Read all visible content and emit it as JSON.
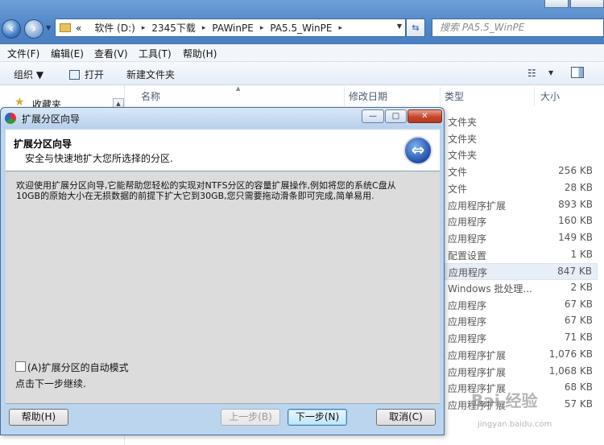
{
  "explorer": {
    "address": {
      "overflow": "«",
      "crumbs": [
        "软件 (D:)",
        "2345下载",
        "PAWinPE",
        "PA5.5_WinPE"
      ]
    },
    "search_placeholder": "搜索 PA5.5_WinPE",
    "menu": [
      "文件(F)",
      "编辑(E)",
      "查看(V)",
      "工具(T)",
      "帮助(H)"
    ],
    "toolbar": {
      "organize": "组织 ▼",
      "open": "打开",
      "new_folder": "新建文件夹"
    },
    "nav_pane": {
      "favorites": "收藏夹"
    },
    "columns": {
      "name": "名称",
      "date": "修改日期",
      "type": "类型",
      "size": "大小"
    },
    "rows": [
      {
        "type": "文件夹",
        "size": ""
      },
      {
        "type": "文件夹",
        "size": ""
      },
      {
        "type": "文件夹",
        "size": ""
      },
      {
        "type": "文件",
        "size": "256 KB"
      },
      {
        "type": "文件",
        "size": "28 KB"
      },
      {
        "type": "应用程序扩展",
        "size": "893 KB"
      },
      {
        "type": "应用程序",
        "size": "160 KB"
      },
      {
        "type": "应用程序",
        "size": "149 KB"
      },
      {
        "type": "配置设置",
        "size": "1 KB"
      },
      {
        "type": "应用程序",
        "size": "847 KB"
      },
      {
        "type": "Windows 批处理...",
        "size": "2 KB"
      },
      {
        "type": "应用程序",
        "size": "67 KB"
      },
      {
        "type": "应用程序",
        "size": "67 KB"
      },
      {
        "type": "应用程序",
        "size": "71 KB"
      },
      {
        "type": "应用程序扩展",
        "size": "1,076 KB"
      },
      {
        "type": "应用程序扩展",
        "size": "1,068 KB"
      },
      {
        "type": "应用程序扩展",
        "size": "68 KB"
      },
      {
        "type": "应用程序扩展",
        "size": "57 KB"
      }
    ],
    "selected_row_index": 9,
    "watermark": {
      "brand": "Bai 经验",
      "url": "jingyan.baidu.com"
    }
  },
  "dialog": {
    "title": "扩展分区向导",
    "header_title": "扩展分区向导",
    "header_subtitle": "安全与快速地扩大您所选择的分区.",
    "body_text": "欢迎使用扩展分区向导,它能帮助您轻松的实现对NTFS分区的容量扩展操作,例如将您的系统C盘从10GB的原始大小在无损数据的前提下扩大它到30GB,您只需要拖动滑条即可完成,简单易用.",
    "auto_mode_label": "(A)扩展分区的自动模式",
    "auto_mode_checked": false,
    "continue_hint": "点击下一步继续.",
    "buttons": {
      "help": "帮助(H)",
      "back": "上一步(B)",
      "next": "下一步(N)",
      "cancel": "取消(C)"
    }
  }
}
